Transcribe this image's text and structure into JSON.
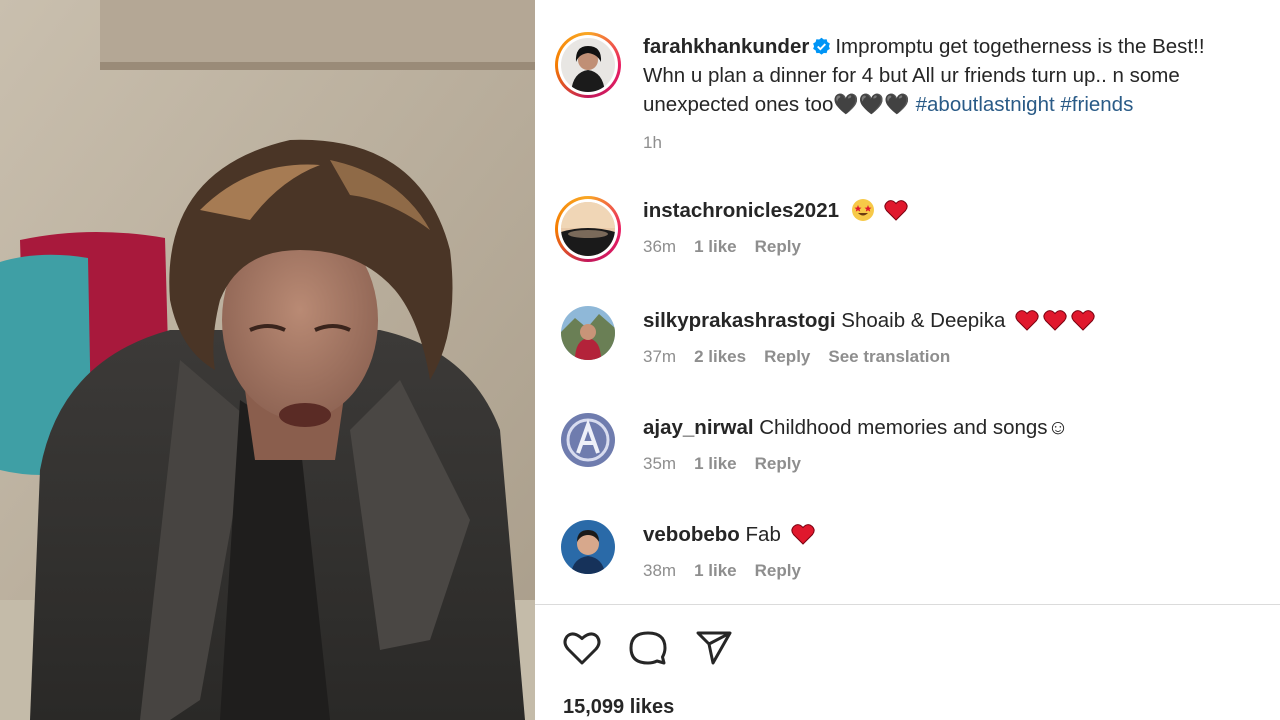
{
  "post": {
    "author": "farahkhankunder",
    "caption_line1": "Impromptu get togetherness is the Best!!",
    "caption_line2": "Whn u plan a dinner for 4 but All ur friends turn up.. n some",
    "caption_line3": "unexpected ones too🖤🖤🖤",
    "hashtags": [
      "#aboutlastnight",
      "#friends"
    ],
    "time": "1h",
    "likes": "15,099 likes"
  },
  "comments": [
    {
      "user": "instachronicles2021",
      "text": "",
      "time": "36m",
      "likes": "1 like",
      "reply": "Reply",
      "extra": ""
    },
    {
      "user": "silkyprakashrastogi",
      "text": "Shoaib & Deepika",
      "time": "37m",
      "likes": "2 likes",
      "reply": "Reply",
      "extra": "See translation"
    },
    {
      "user": "ajay_nirwal",
      "text": "Childhood memories and songs☺",
      "time": "35m",
      "likes": "1 like",
      "reply": "Reply",
      "extra": ""
    },
    {
      "user": "vebobebo",
      "text": "Fab",
      "time": "38m",
      "likes": "1 like",
      "reply": "Reply",
      "extra": ""
    }
  ],
  "icons": {
    "like": "heart-outline-icon",
    "comment": "comment-bubble-icon",
    "share": "paper-plane-icon",
    "verified": "verified-badge-icon"
  },
  "colors": {
    "hashtag": "#2a5b87",
    "verified": "#0095f6",
    "heart_emoji": "#e0182d",
    "meta": "#8e8e8e"
  }
}
